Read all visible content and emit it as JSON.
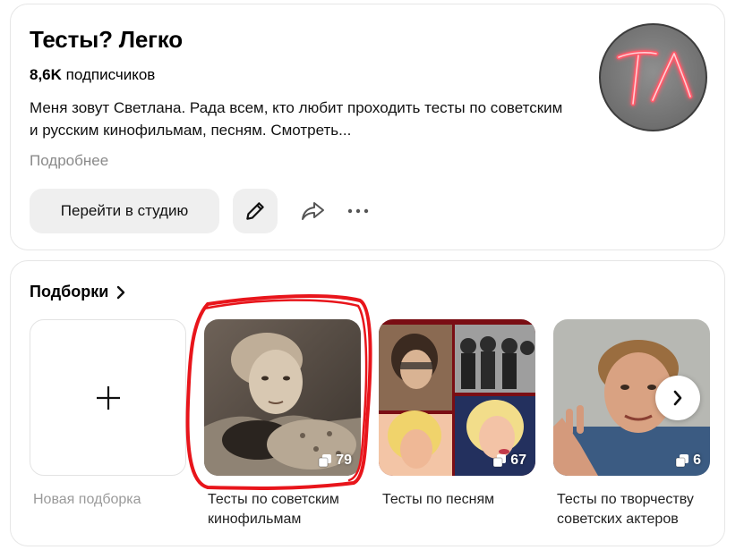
{
  "channel": {
    "title": "Тесты? Легко",
    "subscribers_count": "8,6K",
    "subscribers_label": "подписчиков",
    "description": "Меня зовут Светлана. Рада всем, кто любит проходить тесты по советским и русским кинофильмам, песням. Смотреть...",
    "more_label": "Подробнее",
    "avatar_text": "ТЛ"
  },
  "actions": {
    "studio_label": "Перейти в студию",
    "edit_icon": "pencil-icon",
    "share_icon": "share-icon",
    "more_icon": "more-dots-icon"
  },
  "collections": {
    "title": "Подборки",
    "new_label": "Новая подборка",
    "items": [
      {
        "label": "Тесты по советским кинофильмам",
        "count": "79"
      },
      {
        "label": "Тесты по песням",
        "count": "67"
      },
      {
        "label": "Тесты по творчеству советских актеров",
        "count": "6"
      }
    ]
  },
  "colors": {
    "accent_red": "#e8151b",
    "button_bg": "#efefef",
    "muted_text": "#8a8a8a"
  }
}
